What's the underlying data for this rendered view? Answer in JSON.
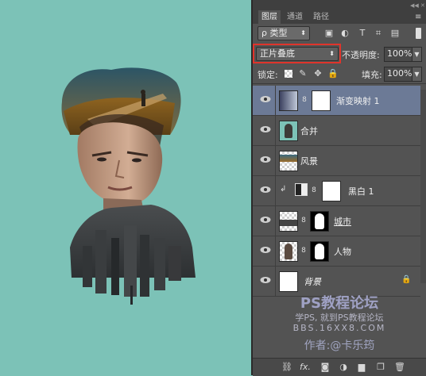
{
  "tabs": {
    "layers": "图层",
    "channels": "通道",
    "paths": "路径"
  },
  "filter": {
    "kind_label": "ρ 类型"
  },
  "blend": {
    "mode": "正片叠底",
    "opacity_label": "不透明度:",
    "opacity_value": "100%"
  },
  "lock": {
    "label": "锁定:",
    "fill_label": "填充:",
    "fill_value": "100%"
  },
  "layers": [
    {
      "name": "渐变映射 1",
      "selected": true
    },
    {
      "name": "合并",
      "selected": false
    },
    {
      "name": "风景",
      "selected": false
    },
    {
      "name": "黑白 1",
      "selected": false
    },
    {
      "name": "城市",
      "selected": false
    },
    {
      "name": "人物",
      "selected": false
    },
    {
      "name": "背景",
      "selected": false
    }
  ],
  "watermark": {
    "line1": "PS教程论坛",
    "line2": "学PS, 就到PS教程论坛",
    "line3": "BBS.16XX8.COM",
    "author": "作者:@卡乐筠"
  },
  "colors": {
    "canvas": "#7cc2b7",
    "panel": "#535353",
    "selected_layer": "#6c7a96",
    "blend_highlight": "#e0342b"
  }
}
